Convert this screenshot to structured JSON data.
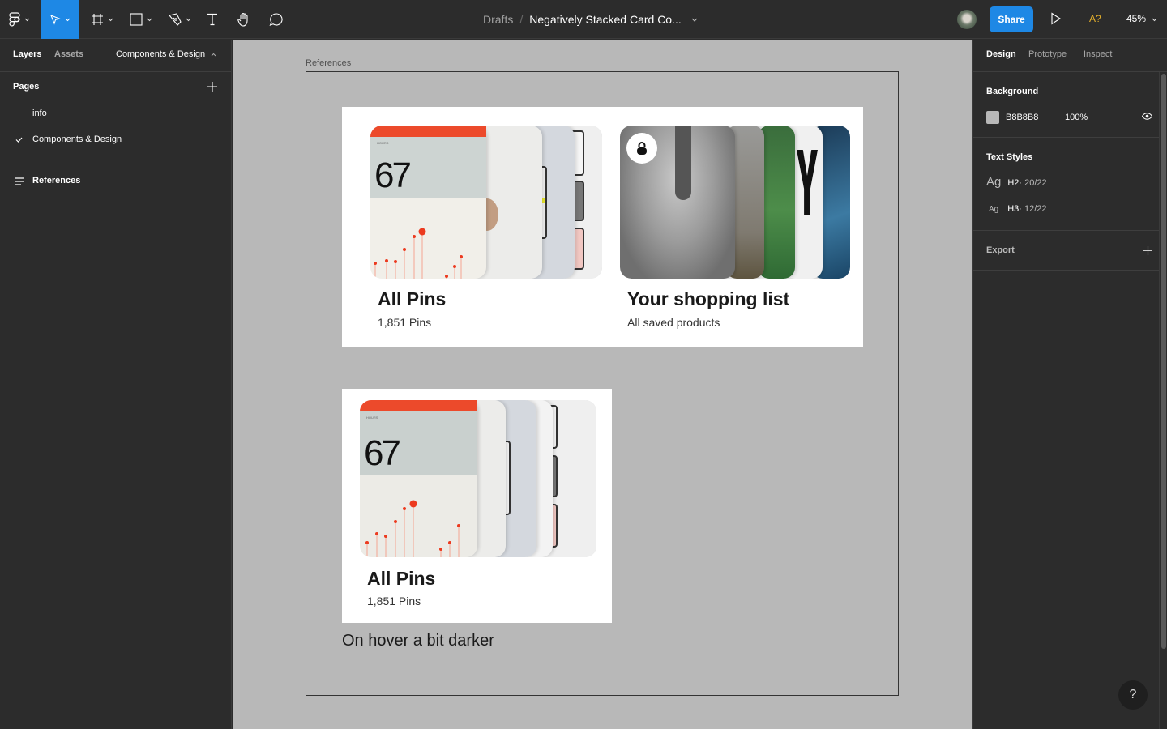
{
  "toolbar": {
    "tools": [
      {
        "name": "main-menu",
        "icon": "figma-logo-icon",
        "active": false
      },
      {
        "name": "move",
        "icon": "move-cursor-icon",
        "active": true
      },
      {
        "name": "frame",
        "icon": "frame-icon",
        "active": false
      },
      {
        "name": "shape",
        "icon": "rectangle-icon",
        "active": false
      },
      {
        "name": "pen",
        "icon": "pen-icon",
        "active": false
      },
      {
        "name": "text",
        "icon": "text-icon",
        "active": false
      },
      {
        "name": "hand",
        "icon": "hand-icon",
        "active": false
      },
      {
        "name": "comment",
        "icon": "comment-icon",
        "active": false
      }
    ],
    "breadcrumb_parent": "Drafts",
    "breadcrumb_sep": "/",
    "file_name": "Negatively Stacked Card Co...",
    "share_label": "Share",
    "missing_fonts_label": "A?",
    "zoom_level": "45%",
    "accent_color": "#1E88E5"
  },
  "left_panel": {
    "tabs": {
      "layers": "Layers",
      "assets": "Assets",
      "page_selector": "Components & Design"
    },
    "pages_heading": "Pages",
    "pages": [
      {
        "label": "info",
        "selected": false
      },
      {
        "label": "Components & Design",
        "selected": true
      }
    ],
    "layers": [
      {
        "label": "References",
        "icon": "frame-layer-icon"
      }
    ]
  },
  "canvas": {
    "background": "#B8B8B8",
    "frame_label": "References",
    "cards": [
      {
        "title": "All Pins",
        "subtitle": "1,851 Pins",
        "preview_number": "67",
        "preview_label": "HOURS"
      },
      {
        "title": "Your shopping list",
        "subtitle": "All saved products",
        "locked": true
      },
      {
        "title": "All Pins",
        "subtitle": "1,851 Pins",
        "preview_number": "67",
        "preview_label": "HOURS"
      }
    ],
    "hover_note": "On hover a bit darker"
  },
  "right_panel": {
    "tabs": {
      "design": "Design",
      "prototype": "Prototype",
      "inspect": "Inspect"
    },
    "background": {
      "heading": "Background",
      "hex": "B8B8B8",
      "opacity": "100%"
    },
    "text_styles": {
      "heading": "Text Styles",
      "items": [
        {
          "sample": "Ag",
          "name": "H2",
          "meta": " · 20/22"
        },
        {
          "sample": "Ag",
          "name": "H3",
          "meta": " · 12/22"
        }
      ]
    },
    "export": {
      "heading": "Export"
    }
  },
  "help_label": "?"
}
